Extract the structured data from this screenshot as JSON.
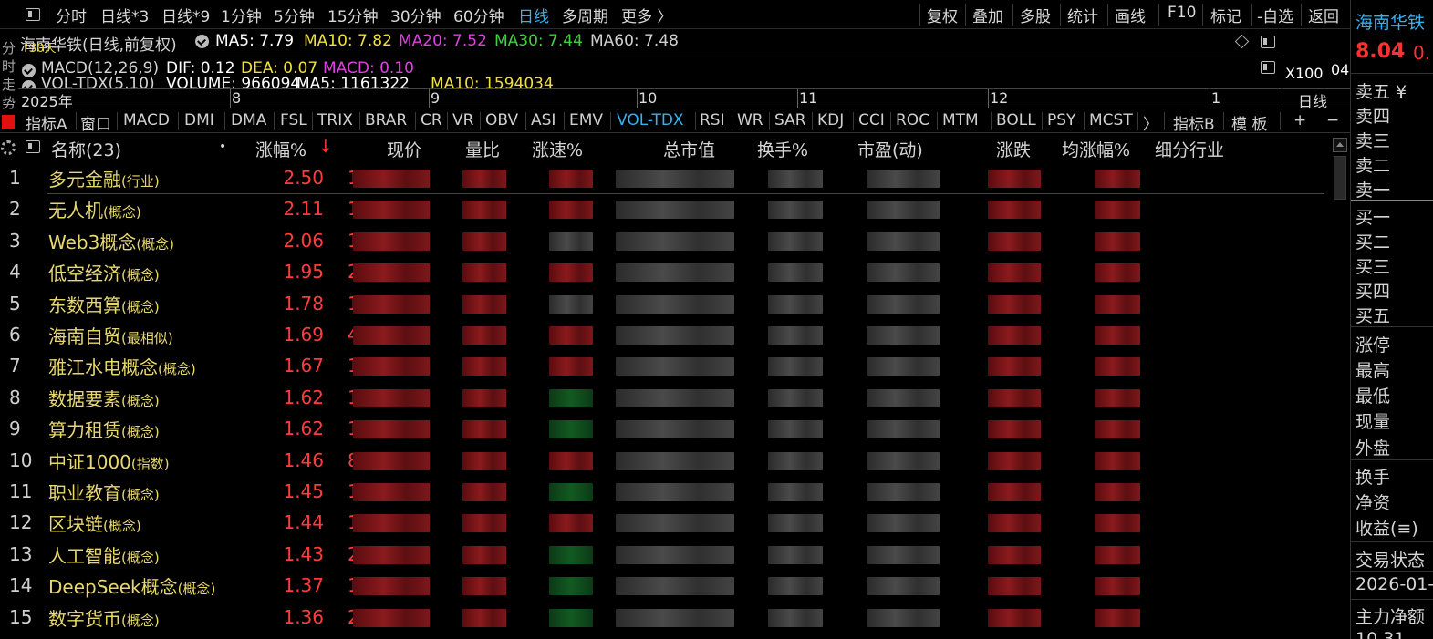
{
  "toolbar": {
    "left_items": [
      "分时",
      "日线*3",
      "日线*9",
      "1分钟",
      "5分钟",
      "15分钟",
      "30分钟",
      "60分钟",
      "日线",
      "多周期",
      "更多 〉"
    ],
    "active_item": "日线",
    "right_items": [
      "复权",
      "叠加",
      "多股",
      "统计",
      "画线",
      "F10",
      "标记",
      "-自选",
      "返回"
    ]
  },
  "left_strip": {
    "chars": [
      "分",
      "时",
      "走",
      "势"
    ]
  },
  "chart_header": {
    "stock_period": "海南华铁(日线,前复权)",
    "overlay_text": "T30天",
    "ma5": "MA5: 7.79",
    "ma10": "MA10: 7.82",
    "ma20": "MA20: 7.52",
    "ma30": "MA30: 7.44",
    "ma60": "MA60: 7.48",
    "colors": {
      "ma5": "#ffffff",
      "ma10": "#f0e040",
      "ma20": "#e040e0",
      "ma30": "#40d040",
      "ma60": "#d0d0d0"
    }
  },
  "indicator_rows": {
    "macd_label": "MACD(12,26,9)",
    "dif": "DIF: 0.12",
    "dea": "DEA: 0.07",
    "macd": "MACD: 0.10",
    "vol_label": "VOL-TDX(5,10)",
    "volume": "VOLUME: 966094",
    "vol_ma5": "MA5: 1161322",
    "vol_ma10": "MA10: 1594034",
    "zoom": "X100",
    "zoom_extra": "04"
  },
  "time_axis": {
    "year": "2025年",
    "months": [
      "8",
      "9",
      "10",
      "11",
      "12",
      "1"
    ],
    "period_label": "日线"
  },
  "indicator_tabs": {
    "left": "指标A",
    "items": [
      "窗口",
      "MACD",
      "DMI",
      "DMA",
      "FSL",
      "TRIX",
      "BRAR",
      "CR",
      "VR",
      "OBV",
      "ASI",
      "EMV",
      "VOL-TDX",
      "RSI",
      "WR",
      "SAR",
      "KDJ",
      "CCI",
      "ROC",
      "MTM",
      "BOLL",
      "PSY",
      "MCST",
      "〉"
    ],
    "active": "VOL-TDX",
    "right": "指标B",
    "template": "模 板",
    "plus": "+",
    "minus": "−"
  },
  "table": {
    "columns": [
      "名称(23)",
      "•",
      "涨幅%",
      "现价",
      "量比",
      "涨速%",
      "总市值",
      "换手%",
      "市盈(动)",
      "涨跌",
      "均涨幅%",
      "细分行业"
    ],
    "sort_arrow": "↓",
    "rows": [
      {
        "num": "1",
        "name": "多元金融",
        "cat": "(行业)",
        "chg": "2.50",
        "pc": "1"
      },
      {
        "num": "2",
        "name": "无人机",
        "cat": "(概念)",
        "chg": "2.11",
        "pc": "1"
      },
      {
        "num": "3",
        "name": "Web3概念",
        "cat": "(概念)",
        "chg": "2.06",
        "pc": "1"
      },
      {
        "num": "4",
        "name": "低空经济",
        "cat": "(概念)",
        "chg": "1.95",
        "pc": "2"
      },
      {
        "num": "5",
        "name": "东数西算",
        "cat": "(概念)",
        "chg": "1.78",
        "pc": "1"
      },
      {
        "num": "6",
        "name": "海南自贸",
        "cat": "(最相似)",
        "chg": "1.69",
        "pc": "4"
      },
      {
        "num": "7",
        "name": "雅江水电概念",
        "cat": "(概念)",
        "chg": "1.67",
        "pc": "1"
      },
      {
        "num": "8",
        "name": "数据要素",
        "cat": "(概念)",
        "chg": "1.62",
        "pc": "1"
      },
      {
        "num": "9",
        "name": "算力租赁",
        "cat": "(概念)",
        "chg": "1.62",
        "pc": "1"
      },
      {
        "num": "10",
        "name": "中证1000",
        "cat": "(指数)",
        "chg": "1.46",
        "pc": "8"
      },
      {
        "num": "11",
        "name": "职业教育",
        "cat": "(概念)",
        "chg": "1.45",
        "pc": "1"
      },
      {
        "num": "12",
        "name": "区块链",
        "cat": "(概念)",
        "chg": "1.44",
        "pc": "1"
      },
      {
        "num": "13",
        "name": "人工智能",
        "cat": "(概念)",
        "chg": "1.43",
        "pc": "2"
      },
      {
        "num": "14",
        "name": "DeepSeek概念",
        "cat": "(概念)",
        "chg": "1.37",
        "pc": "1"
      },
      {
        "num": "15",
        "name": "数字货币",
        "cat": "(概念)",
        "chg": "1.36",
        "pc": "2"
      }
    ]
  },
  "right_panel": {
    "title": "海南华铁",
    "price": "8.04",
    "price_extra": "0.",
    "sell_levels": [
      "卖五 ¥",
      "卖四",
      "卖三",
      "卖二",
      "卖一"
    ],
    "buy_levels": [
      "买一",
      "买二",
      "买三",
      "买四",
      "买五"
    ],
    "stats": [
      "涨停",
      "最高",
      "最低",
      "现量",
      "外盘"
    ],
    "stats2": [
      "换手",
      "净资",
      "收益(≡)"
    ],
    "trade_status": "交易状态",
    "date": "2026-01-",
    "main_net": "主力净额",
    "bottom": "10.31"
  }
}
